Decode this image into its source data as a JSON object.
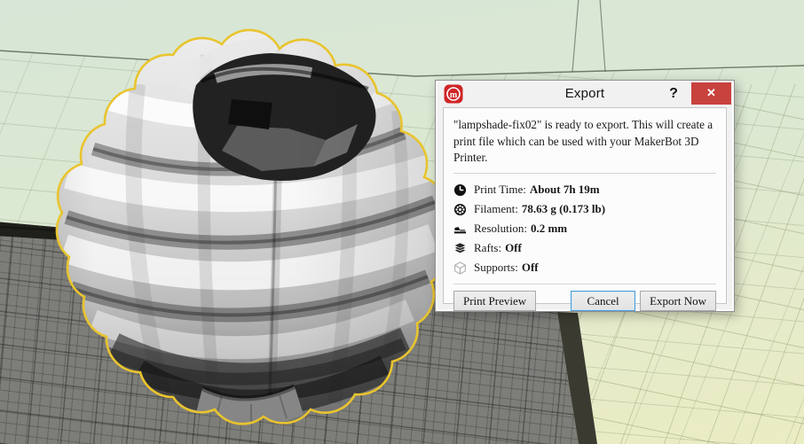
{
  "dialog": {
    "title": "Export",
    "help_label": "?",
    "close_label": "✕",
    "intro_text": "\"lampshade-fix02\" is ready to export. This will create a print file which can be used with your MakerBot 3D Printer.",
    "details": [
      {
        "icon": "clock-icon",
        "label": "Print Time:",
        "value": "About 7h 19m"
      },
      {
        "icon": "filament-spool-icon",
        "label": "Filament:",
        "value": "78.63 g (0.173 lb)"
      },
      {
        "icon": "resolution-layer-icon",
        "label": "Resolution:",
        "value": "0.2 mm"
      },
      {
        "icon": "rafts-icon",
        "label": "Rafts:",
        "value": "Off"
      },
      {
        "icon": "supports-icon",
        "label": "Supports:",
        "value": "Off"
      }
    ],
    "buttons": {
      "print_preview": "Print Preview",
      "cancel": "Cancel",
      "export_now": "Export Now"
    }
  },
  "colors": {
    "close_button_red": "#c8423e",
    "makerbot_logo_red": "#cf2427",
    "selection_outline_yellow": "#e9c42e",
    "build_plate_gray": "#7d7d79",
    "floor_green": "#d7e6d6",
    "floor_yellow": "#eaecc2",
    "focus_border_blue": "#4a9bd6"
  }
}
